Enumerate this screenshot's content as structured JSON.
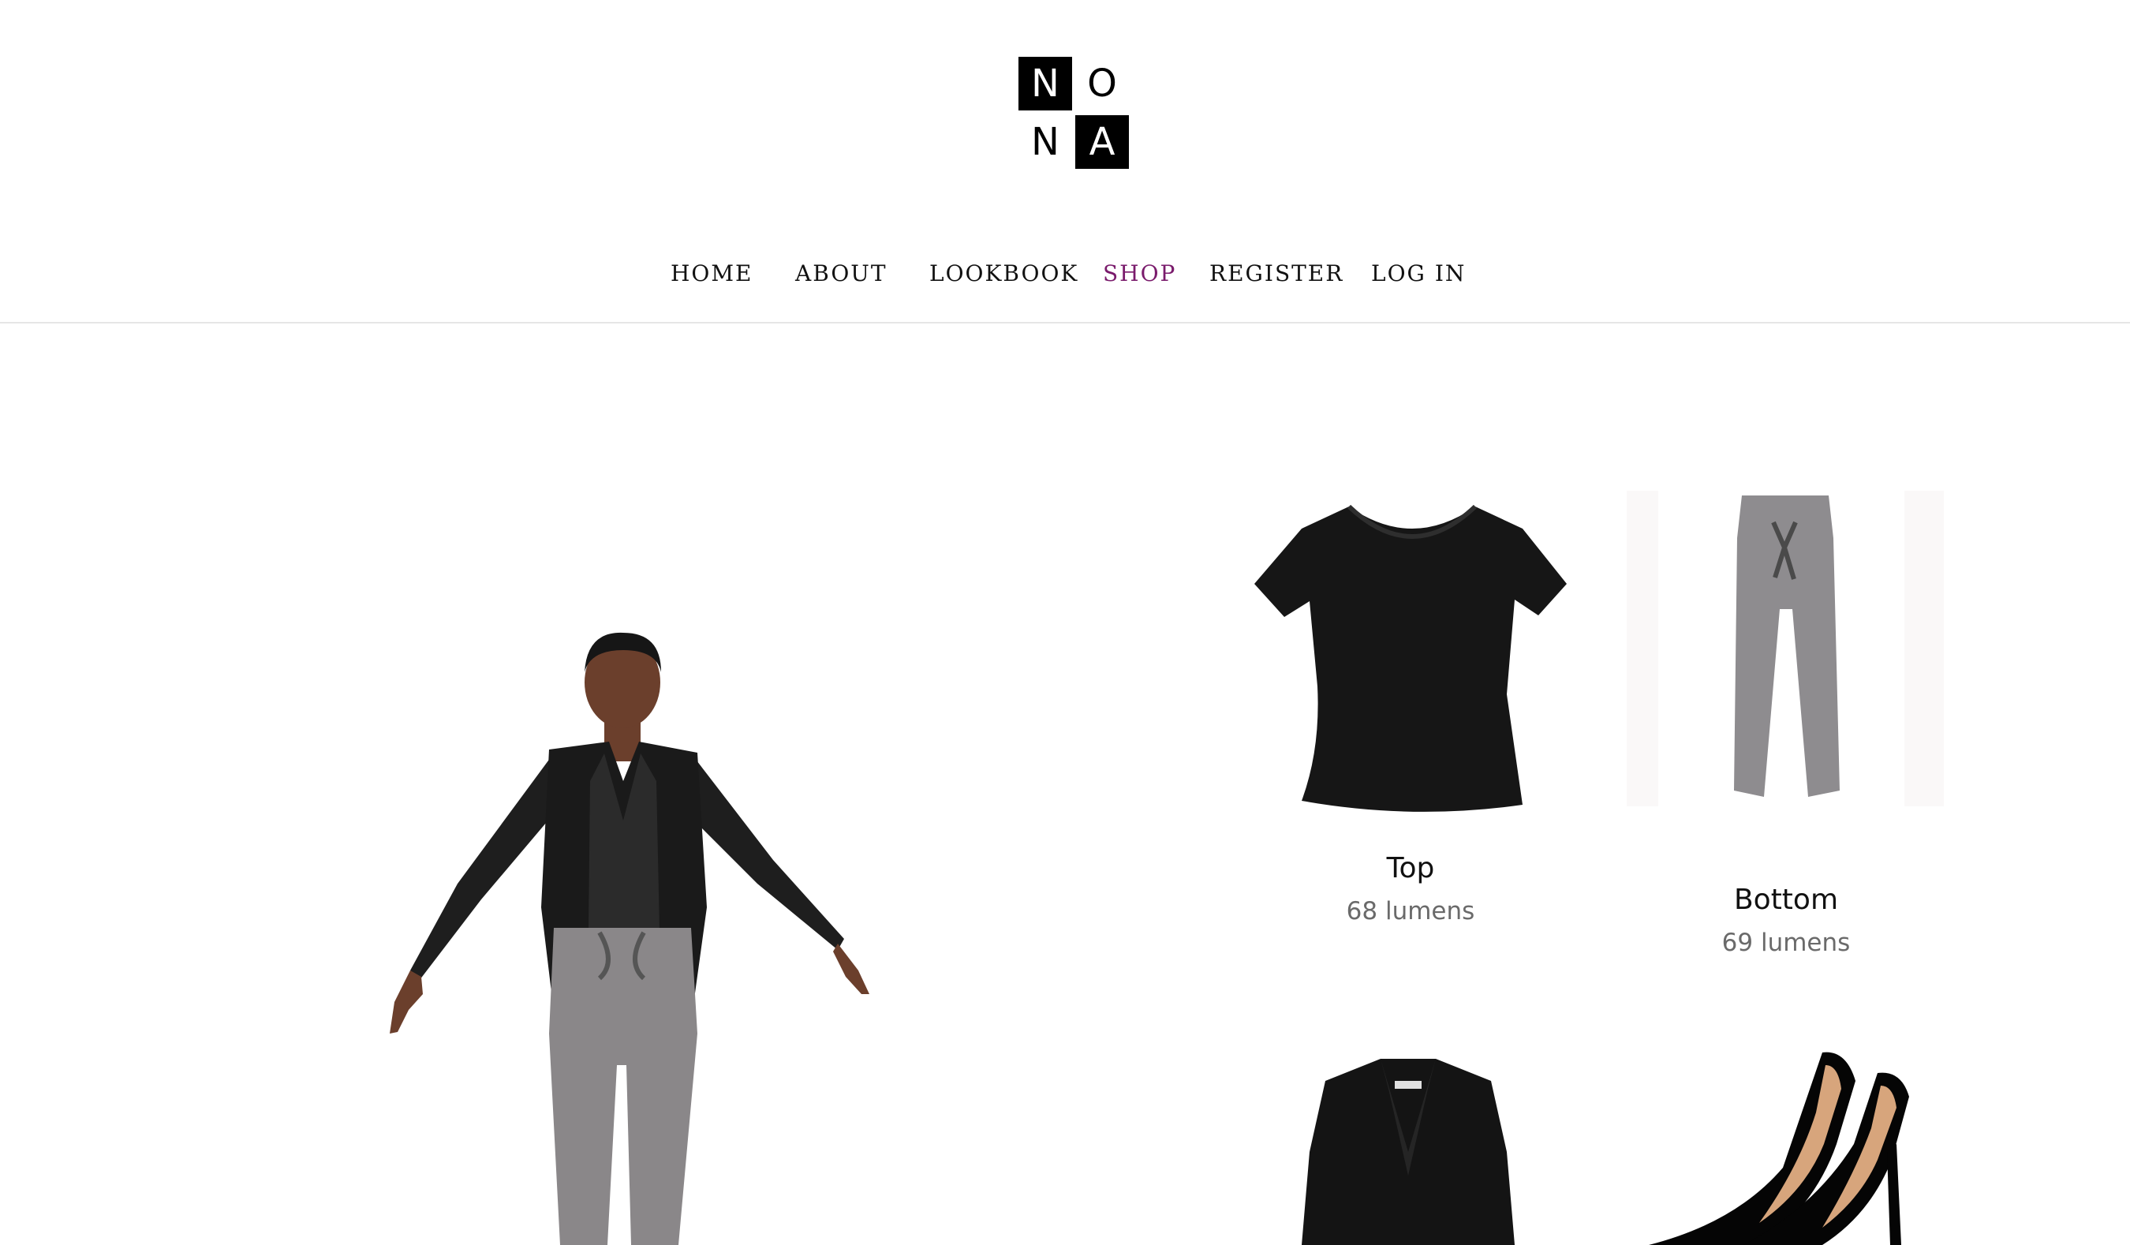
{
  "logo": {
    "letters": [
      "N",
      "O",
      "N",
      "A"
    ]
  },
  "nav": {
    "items": [
      {
        "label": "HOME"
      },
      {
        "label": "ABOUT"
      },
      {
        "label": "LOOKBOOK"
      },
      {
        "label": "SHOP",
        "active": true
      },
      {
        "label": "REGISTER"
      },
      {
        "label": "LOG IN"
      }
    ]
  },
  "colors": {
    "accent": "#7a1b6c",
    "text": "#111111",
    "muted": "#6a6a6a",
    "divider": "#e6e6e6"
  },
  "products": [
    {
      "name": "Top",
      "price": "68 lumens",
      "icon": "tshirt-icon"
    },
    {
      "name": "Bottom",
      "price": "69 lumens",
      "icon": "pants-icon"
    },
    {
      "name": "",
      "price": "",
      "icon": "blazer-icon"
    },
    {
      "name": "",
      "price": "",
      "icon": "high-heels-icon"
    }
  ],
  "avatar": {
    "icon": "avatar-model-icon"
  }
}
